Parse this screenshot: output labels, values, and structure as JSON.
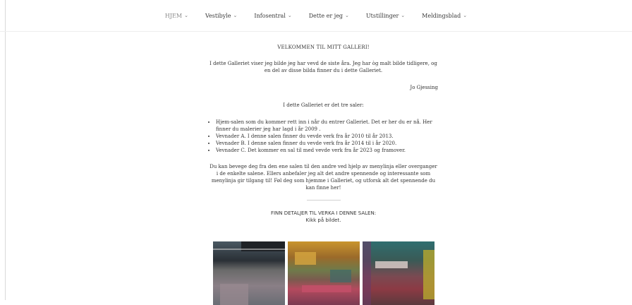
{
  "nav": {
    "items": [
      {
        "label": "HJEM",
        "active": true
      },
      {
        "label": "Vestibyle"
      },
      {
        "label": "Infosentral"
      },
      {
        "label": "Dette er jeg"
      },
      {
        "label": "Utstillinger"
      },
      {
        "label": "Meldingsblad"
      }
    ],
    "chevron_icon": "chevron-down-icon"
  },
  "content": {
    "welcome_title": "VELKOMMEN TIL MITT GALLERI!",
    "intro": "I dette Galleriet viser jeg bilde jeg har vevd de siste åra. Jeg har òg malt bilde tidligere, og en del av disse bilda finner du i dette Galleriet.",
    "signature": "Jo Gjessing",
    "three_rooms": "I dette Galleriet er det tre saler:",
    "rooms": [
      "Hjem-salen som du kommer rett inn i når du entrer Galleriet. Det er her du er nå. Her finner du malerier jeg har lagd i år 2009 .",
      "Vevnader A. I denne salen finner du vevde verk fra år 2010 til år 2013.",
      "Vevnader B. I denne salen finner du vevde verk fra år 2014 til i år 2020.",
      "Vevnader C. Det kommer en sal til med vevde verk fra år 2023 og framover."
    ],
    "move_text": "Du kan bevege deg fra den ene salen til den andre ved hjelp av menylinja eller overganger i de enkelte salene. Ellers anbefaler jeg alt det andre spennende og interessante som menylinja gir tilgang til! Føl deg som hjemme i Galleriet, og utforsk alt det spennende du kan finne her!",
    "details_heading": "FINN DETALJER TIL VERKA I DENNE SALEN:",
    "click_hint": "Kikk på bildet."
  },
  "colors": {
    "nav_active": "#8a8a8a",
    "text": "#333333",
    "divider": "#eeeeee"
  }
}
